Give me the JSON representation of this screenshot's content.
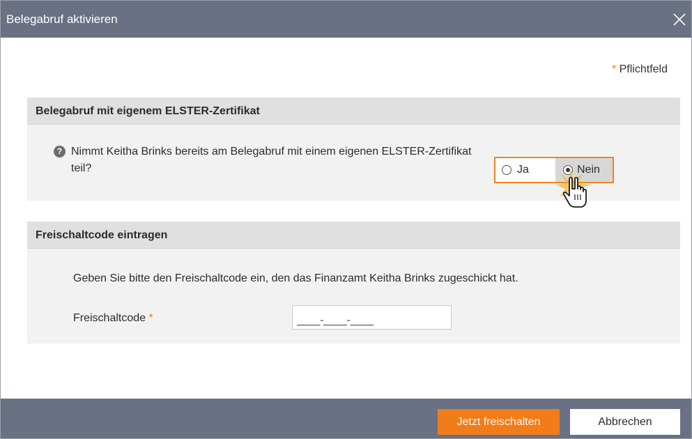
{
  "dialog": {
    "title": "Belegabruf aktivieren",
    "close_icon": "close-icon"
  },
  "required_note": {
    "star": "*",
    "text": "Pflichtfeld"
  },
  "section_certificate": {
    "header": "Belegabruf mit eigenem ELSTER-Zertifikat",
    "help_icon": "question-circle-icon",
    "question": "Nimmt Keitha Brinks bereits am Belegabruf mit einem eigenen ELSTER-Zertifikat teil?",
    "options": [
      {
        "label": "Ja",
        "selected": false
      },
      {
        "label": "Nein",
        "selected": true
      }
    ]
  },
  "section_code": {
    "header": "Freischaltcode eintragen",
    "instruction": "Geben Sie bitte den Freischaltcode ein, den das Finanzamt Keitha Brinks zugeschickt hat.",
    "field_label": "Freischaltcode",
    "field_required_star": "*",
    "field_value": "____-____-____"
  },
  "footer": {
    "primary_button": "Jetzt freischalten",
    "secondary_button": "Abbrechen"
  },
  "colors": {
    "title_bar": "#6a7184",
    "accent": "#f07c1a",
    "section_header": "#e0e0e0",
    "section_body": "#f2f2f2"
  }
}
